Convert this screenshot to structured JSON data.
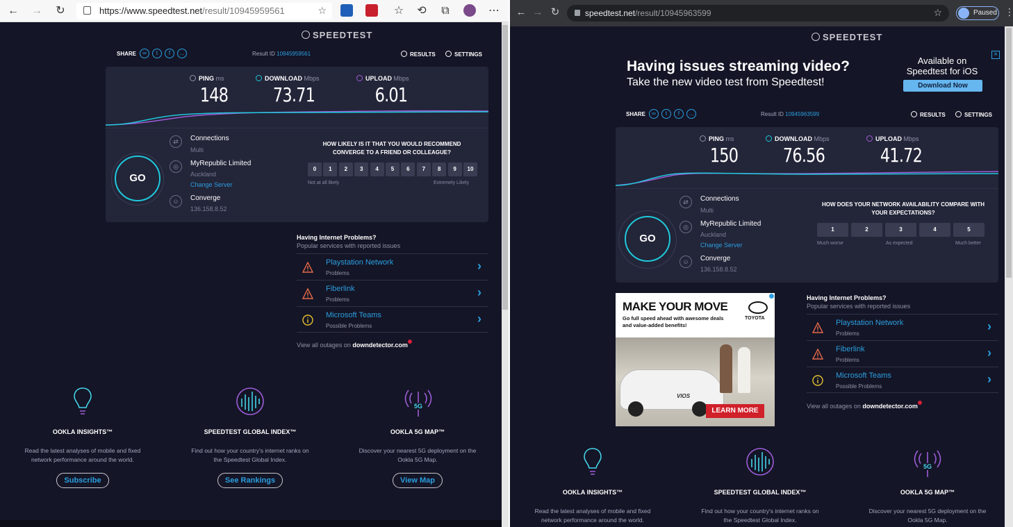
{
  "left_browser": {
    "url_host": "https://www.speedtest.net",
    "url_path": "/result/10945959561"
  },
  "right_browser": {
    "url_host": "speedtest.net",
    "url_path": "/result/10945963599",
    "profile_status": "Paused"
  },
  "logo": "SPEEDTEST",
  "share_label": "SHARE",
  "result_id_label": "Result ID",
  "results_label": "RESULTS",
  "settings_label": "SETTINGS",
  "metric_labels": {
    "ping": "PING",
    "ping_unit": "ms",
    "download": "DOWNLOAD",
    "download_unit": "Mbps",
    "upload": "UPLOAD",
    "upload_unit": "Mbps"
  },
  "go_label": "GO",
  "left_test": {
    "result_id": "10945959561",
    "ping": "148",
    "download": "73.71",
    "upload": "6.01",
    "question": "HOW LIKELY IS IT THAT YOU WOULD RECOMMEND CONVERGE TO A FRIEND OR COLLEAGUE?",
    "scale": [
      "0",
      "1",
      "2",
      "3",
      "4",
      "5",
      "6",
      "7",
      "8",
      "9",
      "10"
    ],
    "scale_low": "Not at all likely",
    "scale_high": "Extremely Likely"
  },
  "right_test": {
    "result_id": "10945963599",
    "ping": "150",
    "download": "76.56",
    "upload": "41.72",
    "question": "HOW DOES YOUR NETWORK AVAILABILITY COMPARE WITH YOUR EXPECTATIONS?",
    "scale": [
      "1",
      "2",
      "3",
      "4",
      "5"
    ],
    "scale_low": "Much worse",
    "scale_mid": "As expected",
    "scale_high": "Much better"
  },
  "connection": {
    "connections_title": "Connections",
    "connections_value": "Multi",
    "isp": "MyRepublic Limited",
    "server_location": "Auckland",
    "change_server": "Change Server",
    "host": "Converge",
    "ip": "136.158.8.52"
  },
  "problems": {
    "heading": "Having Internet Problems?",
    "subheading": "Popular services with reported issues",
    "items": [
      {
        "name": "Playstation Network",
        "status": "Problems",
        "level": "warning"
      },
      {
        "name": "Fiberlink",
        "status": "Problems",
        "level": "warning"
      },
      {
        "name": "Microsoft Teams",
        "status": "Possible Problems",
        "level": "info"
      }
    ],
    "outages_text": "View all outages on",
    "outages_site": "downdetector.com"
  },
  "features": [
    {
      "title": "OOKLA INSIGHTS™",
      "desc": "Read the latest analyses of mobile and fixed network performance around the world.",
      "button": "Subscribe",
      "icon": "lightbulb-icon"
    },
    {
      "title": "SPEEDTEST GLOBAL INDEX™",
      "desc": "Find out how your country's internet ranks on the Speedtest Global Index.",
      "button": "See Rankings",
      "icon": "globe-index-icon"
    },
    {
      "title": "OOKLA 5G MAP™",
      "desc": "Discover your nearest 5G deployment on the Ookla 5G Map.",
      "button": "View Map",
      "icon": "5g-icon",
      "icon_text": "5G"
    }
  ],
  "ios_ad": {
    "headline": "Having issues streaming video?",
    "subline": "Take the new video test from Speedtest!",
    "available": "Available on Speedtest for iOS",
    "button": "Download Now"
  },
  "toyota_ad": {
    "headline": "MAKE YOUR MOVE",
    "body": "Go full speed ahead with awesome deals and value-added benefits!",
    "brand": "TOYOTA",
    "car_model": "VIOS",
    "cta": "LEARN MORE"
  },
  "colors": {
    "background": "#141526",
    "panel": "#232539",
    "accent": "#2b9fe0",
    "download": "#1fc8db",
    "upload": "#9d5dd8",
    "warning": "#e4694a",
    "info": "#e5c230"
  }
}
